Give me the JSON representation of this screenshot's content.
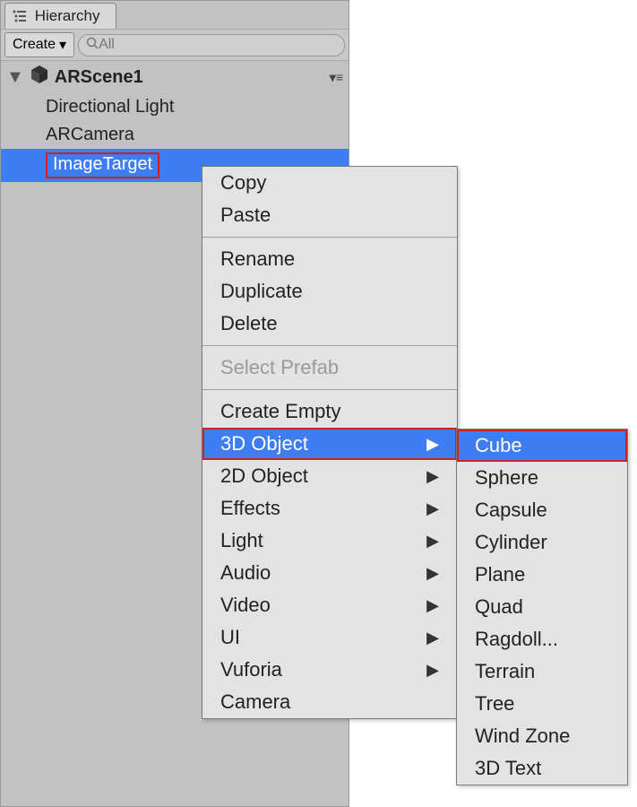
{
  "tab_title": "Hierarchy",
  "toolbar": {
    "create_label": "Create",
    "search_placeholder": "All"
  },
  "scene_name": "ARScene1",
  "hierarchy_items": [
    "Directional Light",
    "ARCamera",
    "ImageTarget"
  ],
  "selected_index": 2,
  "context_menu": {
    "copy": "Copy",
    "paste": "Paste",
    "rename": "Rename",
    "duplicate": "Duplicate",
    "delete": "Delete",
    "select_prefab": "Select Prefab",
    "create_empty": "Create Empty",
    "three_d_object": "3D Object",
    "two_d_object": "2D Object",
    "effects": "Effects",
    "light": "Light",
    "audio": "Audio",
    "video": "Video",
    "ui": "UI",
    "vuforia": "Vuforia",
    "camera": "Camera"
  },
  "submenu_3d": {
    "cube": "Cube",
    "sphere": "Sphere",
    "capsule": "Capsule",
    "cylinder": "Cylinder",
    "plane": "Plane",
    "quad": "Quad",
    "ragdoll": "Ragdoll...",
    "terrain": "Terrain",
    "tree": "Tree",
    "wind_zone": "Wind Zone",
    "three_d_text": "3D Text"
  },
  "highlighted_context_item": "three_d_object",
  "highlighted_submenu_item": "cube"
}
